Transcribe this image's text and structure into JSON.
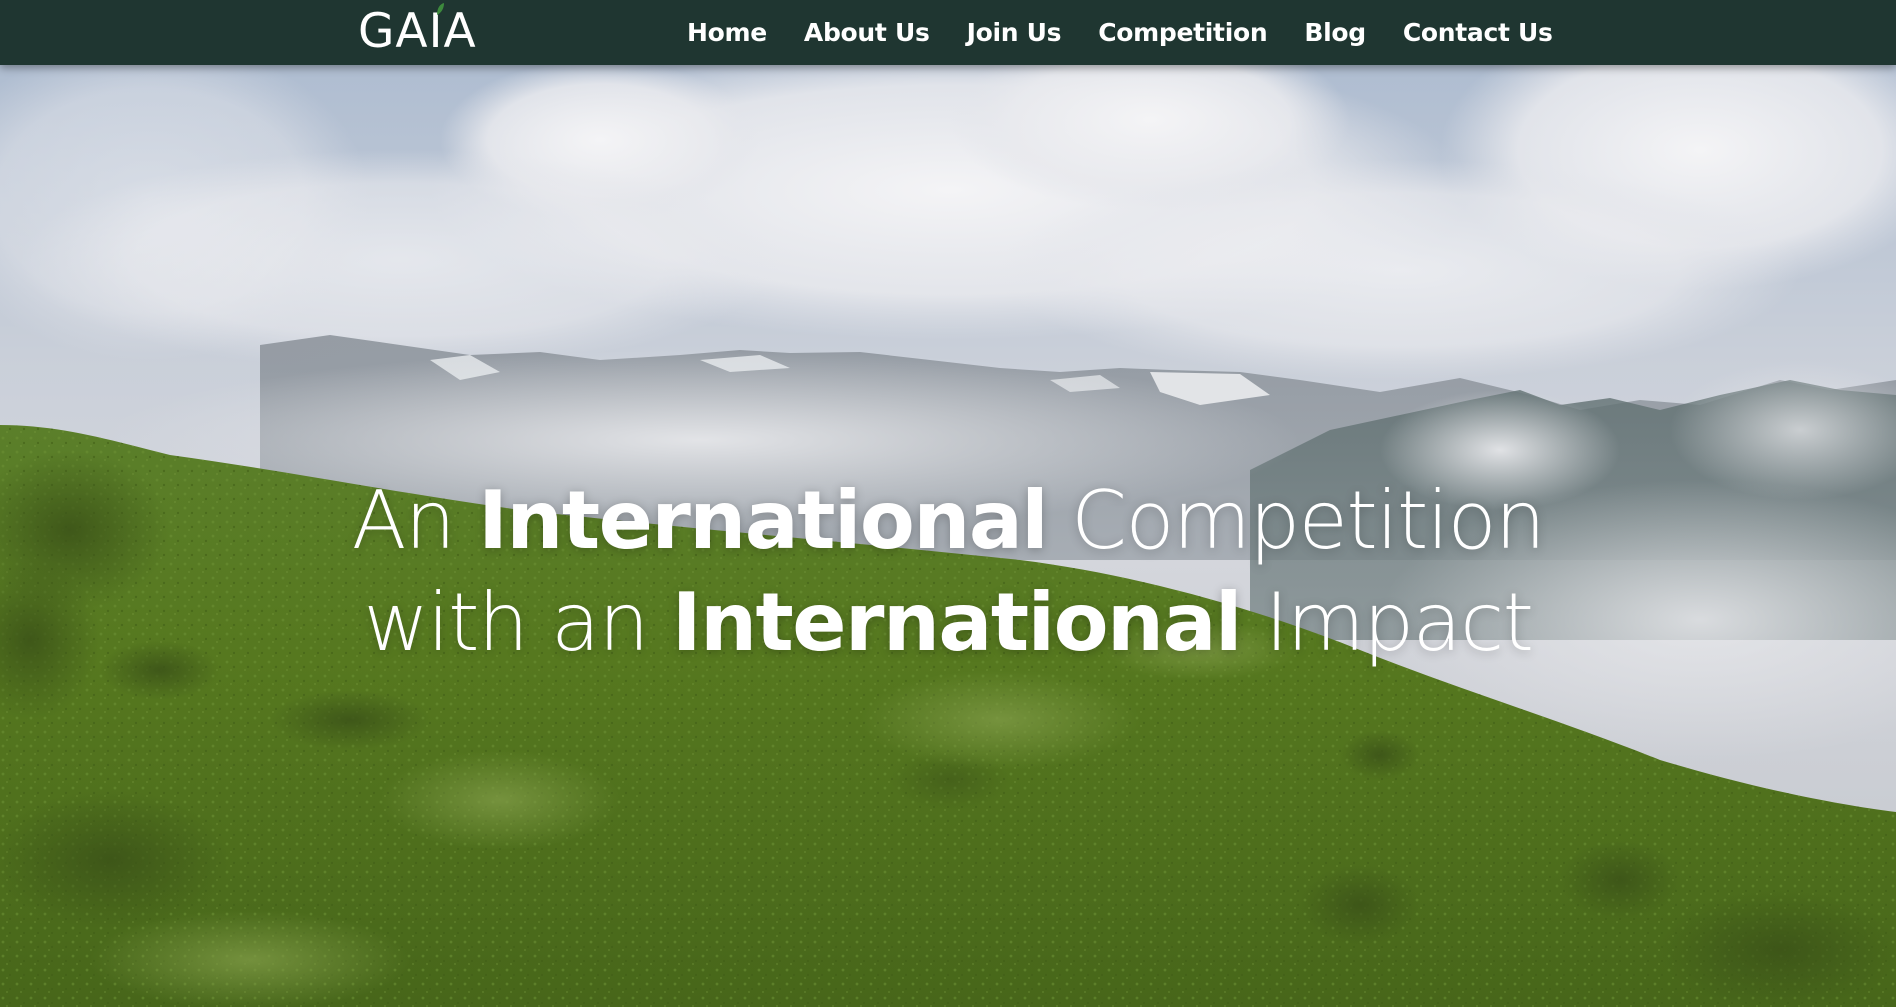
{
  "brand": {
    "logo_text": "GAIA",
    "logo_letters": [
      "G",
      "A",
      "I",
      "A"
    ],
    "accent_color": "#3d8b3d",
    "nav_background": "#1f3631"
  },
  "nav": {
    "items": [
      {
        "label": "Home"
      },
      {
        "label": "About Us"
      },
      {
        "label": "Join Us"
      },
      {
        "label": "Competition"
      },
      {
        "label": "Blog"
      },
      {
        "label": "Contact Us"
      }
    ]
  },
  "hero": {
    "line1": {
      "part1": "An ",
      "part2": "International",
      "part3": " Competition"
    },
    "line2": {
      "part1": "with an ",
      "part2": "International",
      "part3": " Impact"
    }
  }
}
